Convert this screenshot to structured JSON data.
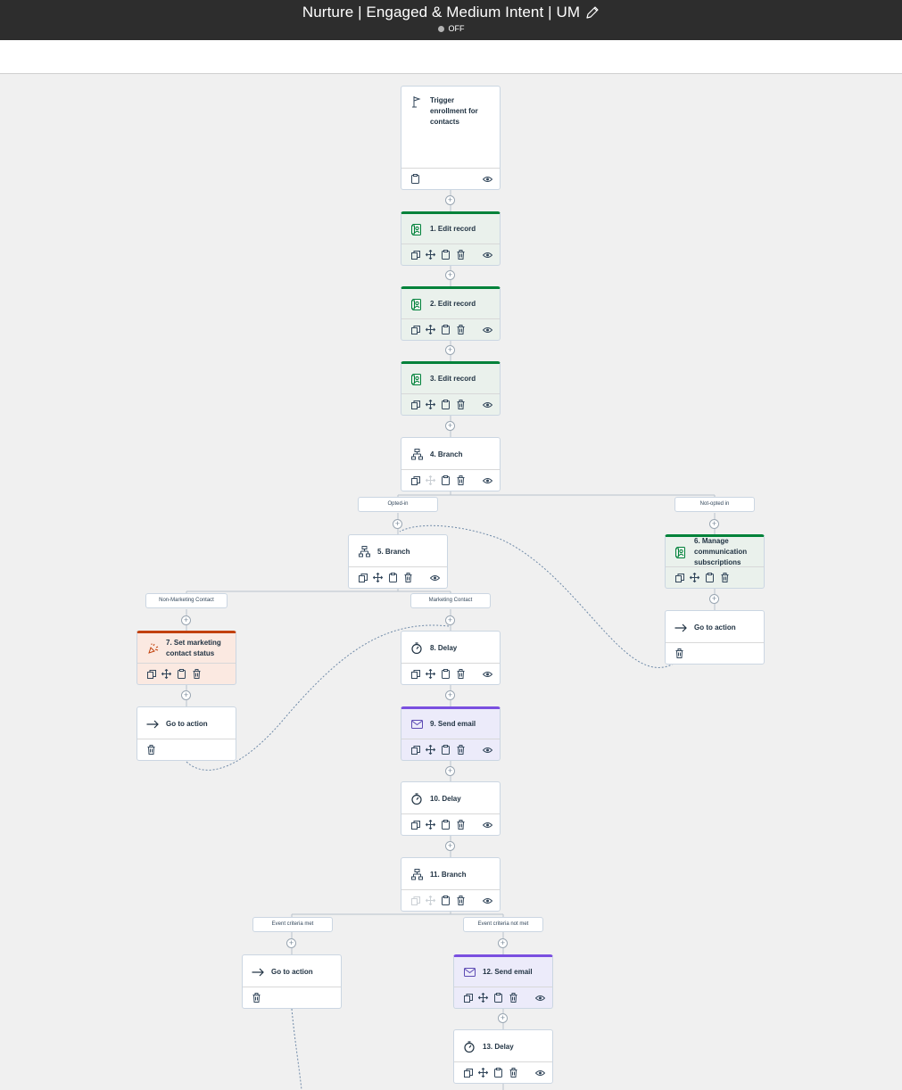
{
  "header": {
    "title": "Nurture | Engaged & Medium Intent | UM",
    "status": "OFF"
  },
  "nodes": {
    "trigger": "Trigger enrollment for contacts",
    "n1": "1. Edit record",
    "n2": "2. Edit record",
    "n3": "3. Edit record",
    "n4": "4. Branch",
    "n5": "5. Branch",
    "n6": "6. Manage communication subscriptions",
    "n6goto": "Go to action",
    "n7": "7. Set marketing contact status",
    "n7goto": "Go to action",
    "n8": "8. Delay",
    "n9": "9. Send email",
    "n10": "10. Delay",
    "n11": "11. Branch",
    "n11goto": "Go to action",
    "n12": "12. Send email",
    "n13": "13. Delay"
  },
  "branches": {
    "opted_in": "Opted-in",
    "not_opted_in": "Not-opted in",
    "non_marketing": "Non-Marketing Contact",
    "marketing": "Marketing Contact",
    "event_met": "Event criteria met",
    "event_not_met": "Event criteria not met"
  },
  "colors": {
    "topbar": "#2d2d2d",
    "edit_record": "#00823a",
    "send_email": "#7a4fe0",
    "marketing_status": "#c2410c",
    "canvas": "#f0f0f0"
  }
}
